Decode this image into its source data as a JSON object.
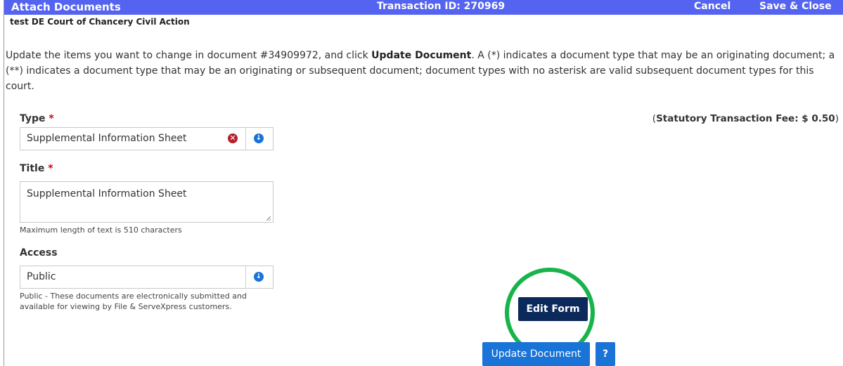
{
  "header": {
    "title": "Attach Documents",
    "transaction_id": "Transaction ID: 270969",
    "cancel_label": "Cancel",
    "save_close_label": "Save & Close",
    "background_color": "#5464f0"
  },
  "case_name": "test  DE Court of Chancery Civil Action",
  "instructions": {
    "part1": "Update the items you want to change in document #34909972, and click ",
    "bold": "Update Document",
    "part2": ". A (*) indicates a document type that may be an originating document; a (**) indicates a document type that may be an originating or subsequent document; document types with no asterisk are valid subsequent document types for this court."
  },
  "type_field": {
    "label": "Type",
    "required_mark": "*",
    "value": "Supplemental Information Sheet",
    "clear_icon": "times-circle-icon",
    "dropdown_icon": "arrow-down-circle-icon"
  },
  "fee": {
    "open_paren": "(",
    "text": "Statutory Transaction Fee: $ 0.50",
    "close_paren": ")"
  },
  "title_field": {
    "label": "Title",
    "required_mark": "*",
    "value": "Supplemental Information Sheet",
    "hint": "Maximum length of text is 510 characters"
  },
  "access_field": {
    "label": "Access",
    "value": "Public",
    "dropdown_icon": "arrow-down-circle-icon",
    "hint": "Public - These documents are electronically submitted and available for viewing by File & ServeXpress customers."
  },
  "buttons": {
    "edit_form": "Edit Form",
    "update_document": "Update Document",
    "help": "?"
  },
  "colors": {
    "primary_blue": "#1a73d6",
    "dark_navy": "#0b2a5b",
    "highlight_ring": "#17b34b",
    "required_red": "#d0021b"
  }
}
